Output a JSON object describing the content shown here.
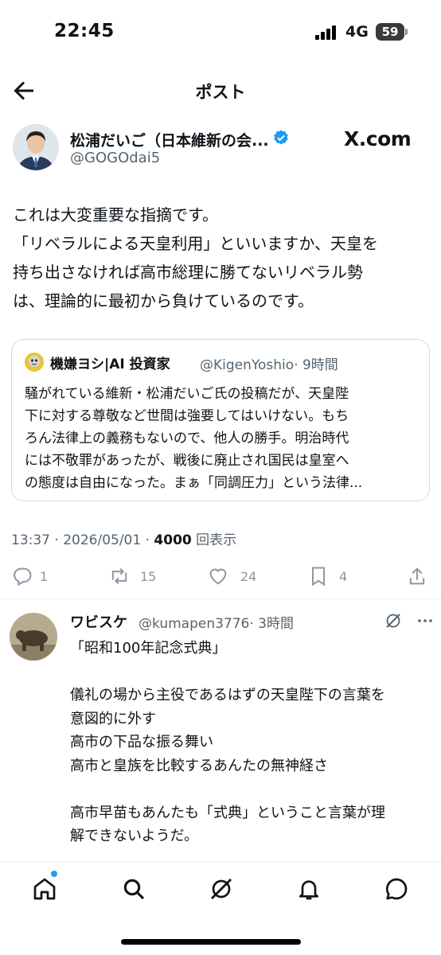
{
  "status_bar": {
    "time": "22:45",
    "network": "4G",
    "battery": "59"
  },
  "header": {
    "title": "ポスト",
    "back_icon": "back-arrow-icon"
  },
  "author": {
    "name": "松浦だいご（日本維新の会...",
    "handle": "@GOGOdai5",
    "verified": true,
    "watermark": "X.com"
  },
  "post": {
    "lines": [
      "これは大変重要な指摘です。",
      "「リベラルによる天皇利用」といいますか、天皇を",
      "持ち出さなければ高市総理に勝てないリベラル勢",
      "は、理論的に最初から負けているのです。"
    ]
  },
  "quote": {
    "name": "機嫌ヨシ|AI 投資家",
    "handle": "@KigenYoshio",
    "time": "· 9時間",
    "lines": [
      "騒がれている維新・松浦だいご氏の投稿だが、天皇陛",
      "下に対する尊敬など世間は強要してはいけない。もち",
      "ろん法律上の義務もないので、他人の勝手。明治時代",
      "には不敬罪があったが、戦後に廃止され国民は皇室へ",
      "の態度は自由になった。まぁ「同調圧力」という法律..."
    ]
  },
  "meta": {
    "time": "13:37 · 2026/05/01 · ",
    "views": "4000",
    "views_label": " 回表示"
  },
  "actions": {
    "replies": "1",
    "reposts": "15",
    "likes": "24",
    "bookmarks": "4"
  },
  "reply": {
    "name": "ワビスケ",
    "handle": "@kumapen3776",
    "time": "· 3時間",
    "text": "「昭和100年記念式典」\n\n儀礼の場から主役であるはずの天皇陛下の言葉を\n意図的に外す\n高市の下品な振る舞い\n高市と皇族を比較するあんたの無神経さ\n\n高市早苗もあんたも「式典」ということ言葉が理\n解できないようだ。\n\n日本人としてあり得ない"
  },
  "tabbar": {
    "tabs": [
      "home-icon",
      "search-icon",
      "grok-icon",
      "notifications-icon",
      "messages-icon"
    ],
    "accent": "#1d9bf0"
  },
  "colors": {
    "text": "#0f1419",
    "secondary": "#536471",
    "verified": "#1d9bf0"
  }
}
